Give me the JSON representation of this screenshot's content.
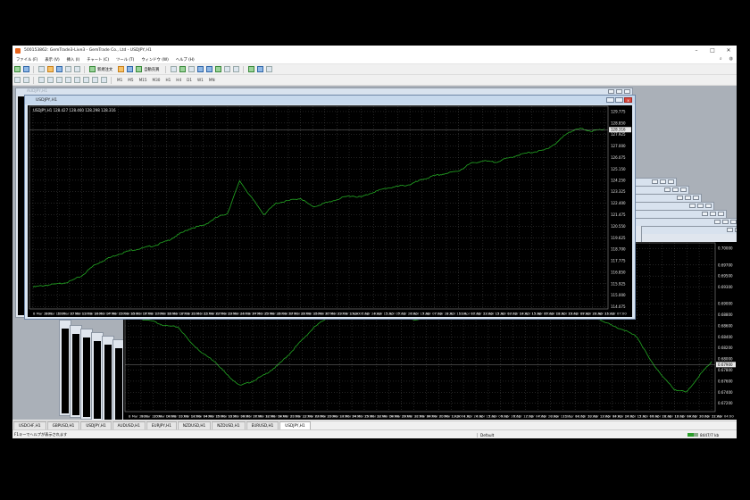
{
  "window": {
    "title": "500153862: GemTrade3-Live3 - GemTrade Co., Ltd - USDJPY,H1",
    "controls": [
      "–",
      "□",
      "✕"
    ]
  },
  "menu": {
    "items": [
      "ファイル (F)",
      "表示 (V)",
      "挿入 (I)",
      "チャート (C)",
      "ツール (T)",
      "ウィンドウ (W)",
      "ヘルプ (H)"
    ],
    "right": [
      "⌕",
      "◍"
    ]
  },
  "toolbar": {
    "new_order": "新規注文",
    "auto_trading": "自動売買",
    "timeframes": [
      "M1",
      "M5",
      "M15",
      "M30",
      "H1",
      "H4",
      "D1",
      "W1",
      "MN"
    ]
  },
  "back_window": {
    "title": "AUDJPY,H1"
  },
  "chart_window": {
    "title": "USDJPY,H1",
    "info": "USDJPY,H1  128.427 128.460 128.298 128.316",
    "current_price": "128.316"
  },
  "chart_data": [
    {
      "type": "line",
      "symbol": "USDJPY,H1",
      "x": [
        "8 Mar 2022",
        "9 Mar 15:00",
        "10 Mar 07:00",
        "10 Mar 23:00",
        "11 Mar 15:00",
        "14 Mar 07:00",
        "14 Mar 23:00",
        "15 Mar 15:00",
        "16 Mar 07:00",
        "16 Mar 23:00",
        "17 Mar 15:00",
        "18 Mar 07:00",
        "18 Mar 23:00",
        "21 Mar 15:00",
        "22 Mar 07:00",
        "22 Mar 23:00",
        "23 Mar 15:00",
        "24 Mar 07:00",
        "24 Mar 23:00",
        "25 Mar 15:00",
        "28 Mar 07:00",
        "28 Mar 23:00",
        "29 Mar 15:00",
        "30 Mar 07:00",
        "30 Mar 23:00",
        "31 Mar 15:00",
        "1 Apr 07:00",
        "1 Apr 23:00",
        "4 Apr 15:00",
        "5 Apr 07:00",
        "5 Apr 23:00",
        "6 Apr 15:00",
        "7 Apr 07:00",
        "7 Apr 23:00",
        "8 Apr 15:00",
        "11 Apr 07:00",
        "11 Apr 23:00",
        "12 Apr 15:00",
        "13 Apr 07:00",
        "13 Apr 23:00",
        "14 Apr 15:00",
        "15 Apr 07:00",
        "15 Apr 23:00",
        "18 Apr 15:00",
        "19 Apr 07:00",
        "19 Apr 23:00",
        "20 Apr 15:00",
        "21 Apr 07:00"
      ],
      "y": [
        115.65,
        115.8,
        115.9,
        116.1,
        116.55,
        117.4,
        117.9,
        118.3,
        118.6,
        118.8,
        119.0,
        119.35,
        119.9,
        120.4,
        120.6,
        121.2,
        121.6,
        124.2,
        122.8,
        121.5,
        122.4,
        122.6,
        122.8,
        122.1,
        122.4,
        122.7,
        123.0,
        122.9,
        123.3,
        123.6,
        123.75,
        123.9,
        124.3,
        124.6,
        124.8,
        125.0,
        125.6,
        125.8,
        125.7,
        126.0,
        126.3,
        126.5,
        126.65,
        127.2,
        128.1,
        128.4,
        128.2,
        128.35
      ],
      "x_ticks": [
        "8 Mar 2022",
        "9 Mar 15:00",
        "10 Mar 07:00",
        "10 Mar 23:00",
        "11 Mar 15:00",
        "14 Mar 07:00",
        "14 Mar 23:00",
        "15 Mar 15:00",
        "16 Mar 07:00",
        "16 Mar 23:00",
        "17 Mar 15:00",
        "18 Mar 07:00",
        "18 Mar 23:00",
        "21 Mar 15:00",
        "22 Mar 07:00",
        "22 Mar 23:00",
        "23 Mar 15:00",
        "24 Mar 07:00",
        "24 Mar 23:00",
        "25 Mar 15:00",
        "28 Mar 07:00",
        "28 Mar 23:00",
        "29 Mar 15:00",
        "30 Mar 07:00",
        "30 Mar 23:00",
        "31 Mar 15:00",
        "1 Apr 07:00",
        "1 Apr 23:00",
        "4 Apr 15:00",
        "5 Apr 07:00",
        "5 Apr 23:00",
        "6 Apr 15:00",
        "7 Apr 07:00",
        "7 Apr 23:00",
        "8 Apr 15:00",
        "11 Apr 07:00",
        "11 Apr 23:00",
        "12 Apr 15:00",
        "13 Apr 07:00",
        "13 Apr 23:00",
        "14 Apr 15:00",
        "15 Apr 07:00",
        "15 Apr 23:00",
        "18 Apr 15:00",
        "19 Apr 07:00",
        "19 Apr 23:00",
        "20 Apr 15:00",
        "21 Apr 07:00"
      ],
      "y_ticks": [
        "129.775",
        "128.850",
        "128.316",
        "127.925",
        "127.000",
        "126.075",
        "125.150",
        "124.250",
        "123.325",
        "122.400",
        "121.475",
        "120.550",
        "119.625",
        "118.700",
        "117.775",
        "116.850",
        "115.925",
        "115.000",
        "114.075"
      ],
      "ylim": [
        113.9,
        130.2
      ],
      "color": "#23a823",
      "grid": true,
      "grid_style": "dotted"
    },
    {
      "type": "line",
      "symbol": "USDCHF,H1",
      "x": [
        "8 Mar 2022",
        "9 Mar 12:00",
        "10 Mar 04:00",
        "10 Mar 20:00",
        "11 Mar 12:00",
        "14 Mar 04:00",
        "14 Mar 20:00",
        "15 Mar 12:00",
        "16 Mar 04:00",
        "16 Mar 20:00",
        "17 Mar 12:00",
        "18 Mar 04:00",
        "18 Mar 20:00",
        "21 Mar 12:00",
        "22 Mar 04:00",
        "22 Mar 20:00",
        "23 Mar 12:00",
        "24 Mar 04:00",
        "24 Mar 20:00",
        "25 Mar 12:00",
        "28 Mar 04:00",
        "28 Mar 20:00",
        "29 Mar 12:00",
        "30 Mar 04:00",
        "30 Mar 20:00",
        "31 Mar 12:00",
        "1 Apr 04:00",
        "1 Apr 20:00",
        "4 Apr 12:00",
        "5 Apr 04:00",
        "5 Apr 20:00",
        "6 Apr 12:00",
        "7 Apr 04:00",
        "7 Apr 20:00",
        "8 Apr 12:00",
        "11 Apr 04:00",
        "11 Apr 20:00",
        "12 Apr 12:00",
        "13 Apr 04:00",
        "13 Apr 20:00",
        "14 Apr 12:00",
        "15 Apr 04:00",
        "15 Apr 20:00",
        "18 Apr 12:00",
        "19 Apr 04:00",
        "19 Apr 20:00",
        "20 Apr 12:00",
        "21 Apr 04:00"
      ],
      "y": [
        0.6885,
        0.6872,
        0.6868,
        0.686,
        0.6858,
        0.683,
        0.681,
        0.6795,
        0.677,
        0.6752,
        0.676,
        0.6772,
        0.6788,
        0.681,
        0.6835,
        0.6858,
        0.6875,
        0.6882,
        0.688,
        0.6878,
        0.6876,
        0.6874,
        0.6878,
        0.687,
        0.6876,
        0.6878,
        0.688,
        0.6878,
        0.6876,
        0.688,
        0.6878,
        0.6876,
        0.6878,
        0.6874,
        0.6872,
        0.6876,
        0.6878,
        0.6874,
        0.6872,
        0.686,
        0.6852,
        0.684,
        0.68,
        0.677,
        0.6745,
        0.674,
        0.677,
        0.6795
      ],
      "x_ticks": [
        "8 Mar 2022",
        "9 Mar 12:00",
        "10 Mar 04:00",
        "10 Mar 20:00",
        "11 Mar 12:00",
        "14 Mar 04:00",
        "14 Mar 20:00",
        "15 Mar 12:00",
        "16 Mar 04:00",
        "16 Mar 20:00",
        "17 Mar 12:00",
        "18 Mar 04:00",
        "18 Mar 20:00",
        "21 Mar 12:00",
        "22 Mar 04:00",
        "22 Mar 20:00",
        "23 Mar 12:00",
        "24 Mar 04:00",
        "24 Mar 20:00",
        "25 Mar 12:00",
        "28 Mar 04:00",
        "28 Mar 20:00",
        "29 Mar 12:00",
        "30 Mar 04:00",
        "30 Mar 20:00",
        "31 Mar 12:00",
        "1 Apr 04:00",
        "1 Apr 20:00",
        "4 Apr 12:00",
        "5 Apr 04:00",
        "5 Apr 20:00",
        "6 Apr 12:00",
        "7 Apr 04:00",
        "7 Apr 20:00",
        "8 Apr 12:00",
        "11 Apr 04:00",
        "11 Apr 20:00",
        "12 Apr 12:00",
        "13 Apr 04:00",
        "13 Apr 20:00",
        "14 Apr 12:00",
        "15 Apr 04:00",
        "15 Apr 20:00",
        "18 Apr 12:00",
        "19 Apr 04:00",
        "19 Apr 20:00",
        "20 Apr 12:00",
        "21 Apr 04:00"
      ],
      "y_ticks": [
        "0.70000",
        "0.69700",
        "0.69500",
        "0.69300",
        "0.69000",
        "0.68800",
        "0.68600",
        "0.68400",
        "0.68200",
        "0.68000",
        "0.67800",
        "0.67600",
        "0.67400",
        "0.67200"
      ],
      "current_price": "0.67900",
      "ylim": [
        0.6705,
        0.701
      ],
      "color": "#23a823",
      "grid": true
    }
  ],
  "tabs": [
    "USDCHF,H1",
    "GBPUSD,H1",
    "USDJPY,H1",
    "AUDUSD,H1",
    "EURJPY,H1",
    "NZDUSD,H1",
    "NZDUSD,H1",
    "EURUSD,H1",
    "USDJPY,H1"
  ],
  "active_tab_index": 8,
  "status": {
    "help_text": "F1キーでヘルプが表示されます",
    "profile": "Default",
    "connection": "8447/7 kb"
  }
}
